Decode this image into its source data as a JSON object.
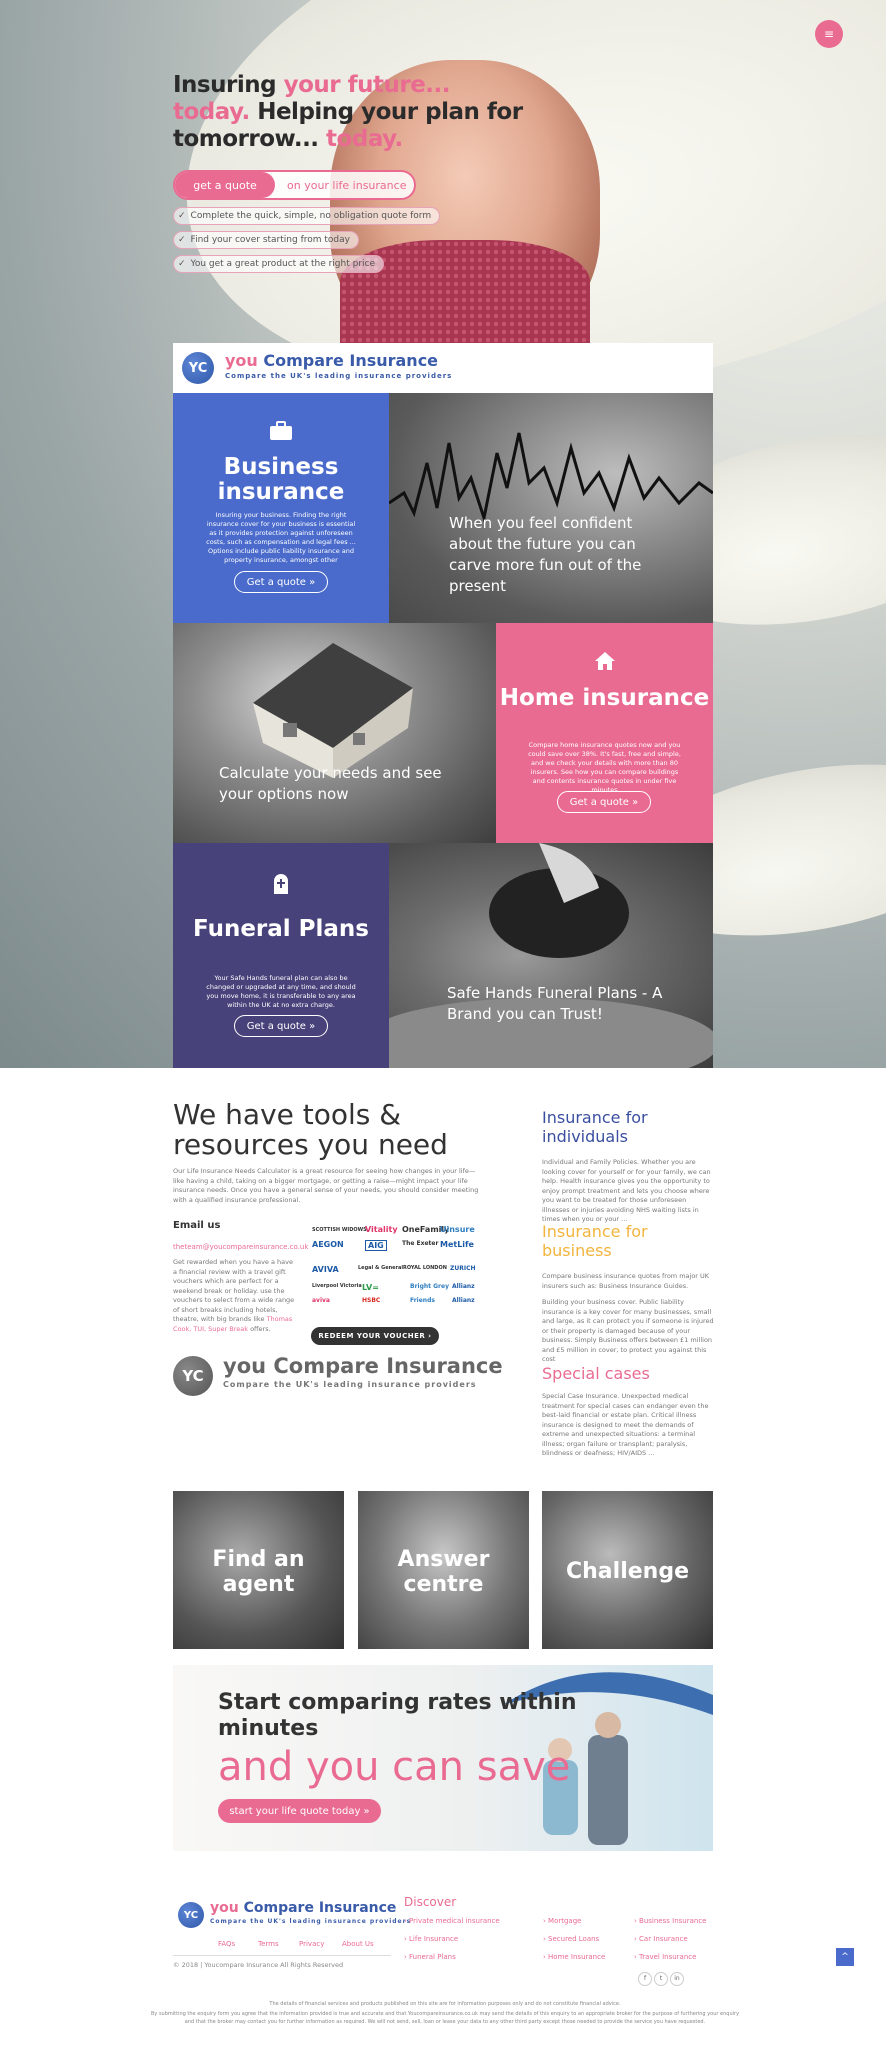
{
  "menu": {
    "icon": "≡"
  },
  "hero": {
    "line1a": "Insuring ",
    "line1b": "your future...",
    "line2a": "today.",
    "line2b": " Helping your plan for",
    "line3a": "tomorrow...",
    "line3b": " today.",
    "cta_button": "get a quote",
    "cta_text": "on your life insurance",
    "checks": [
      "Complete the quick, simple, no obligation quote form",
      "Find your cover starting from today",
      "You get a great product at the right price"
    ]
  },
  "logo": {
    "mark": "YC",
    "name_a": "you ",
    "name_b": "Compare Insurance",
    "tagline": "Compare the UK's leading insurance providers"
  },
  "tiles": {
    "business": {
      "icon": "briefcase-icon",
      "title": "Business insurance",
      "text": "Insuring your business. Finding the right insurance cover for your business is essential as it provides protection against unforeseen costs, such as compensation and legal fees ... Options include public liability insurance and property insurance, amongst other",
      "button": "Get a quote »"
    },
    "confident": {
      "caption": "When you feel confident about the future you can carve more fun out of the present"
    },
    "calculate": {
      "caption": "Calculate your needs and see your options now"
    },
    "home": {
      "icon": "home-icon",
      "title": "Home insurance",
      "text": "Compare home insurance quotes now and you could save over 38%. It's fast, free and simple, and we check your details with more than 80 insurers. See how you can compare buildings and contents insurance quotes in under five minutes",
      "button": "Get a quote »"
    },
    "funeral": {
      "icon": "headstone-icon",
      "title": "Funeral Plans",
      "text": "Your Safe Hands funeral plan can also be changed or upgraded at any time, and should you move home, it is transferable to any area within the UK at no extra charge.",
      "button": "Get a quote »"
    },
    "safehands": {
      "caption": "Safe Hands Funeral Plans - A Brand you can Trust!"
    }
  },
  "tools": {
    "title": "We have tools & resources you need",
    "intro": "Our Life Insurance Needs Calculator is a great resource for seeing how changes in your life—like having a child, taking on a bigger mortgage, or getting a raise—might impact your life insurance needs. Once you have a general sense of your needs, you should consider meeting with a qualified insurance professional.",
    "email_heading": "Email us",
    "email": "theteam@youcompareinsurance.co.uk",
    "voucher_text_a": "Get rewarded when you have a have a financial review with a travel gift vouchers which are perfect for a weekend break or holiday. use the vouchers to select from a wide range of short breaks including hotels, theatre, with big brands like ",
    "voucher_brands": "Thomas Cook, TUI, Super Break",
    "voucher_text_b": " offers.",
    "voucher_button": "REDEEM YOUR VOUCHER ›",
    "brands": [
      "SCOTTISH WIDOWS",
      "Vitality",
      "OneFamily",
      "Uinsure",
      "AEGON",
      "AIG",
      "The Exeter",
      "MetLife",
      "AVIVA",
      "Legal & General",
      "ROYAL LONDON",
      "ZURICH",
      "Liverpool Victoria",
      "LV=",
      "Bright Grey",
      "Allianz",
      "aviva",
      "HSBC",
      "Friends",
      "Allianz"
    ]
  },
  "sidebar": {
    "individuals_title": "Insurance for individuals",
    "individuals_text": "Individual and Family Policies. Whether you are looking cover for yourself or for your family, we can help. Health insurance gives you the opportunity to enjoy prompt treatment and lets you choose where you want to be treated for those unforeseen illnesses or injuries avoiding NHS waiting lists in times when you or your ...",
    "business_title": "Insurance for business",
    "business_text1": "Compare business insurance quotes from major UK insurers such as: Business Insurance Guides.",
    "business_text2": "Building your business cover. Public liability insurance is a key cover for many businesses, small and large, as it can protect you if someone is injured or their property is damaged because of your business. Simply Business offers between £1 million and £5 million in cover, to protect you against this cost",
    "special_title": "Special cases",
    "special_text": "Special Case Insurance. Unexpected medical treatment for special cases can endanger even the best-laid financial or estate plan. Critical illness insurance is designed to meet the demands of extreme and unexpected situations: a terminal illness; organ failure or transplant; paralysis, blindness or deafness; HIV/AIDS ..."
  },
  "bottom_tiles": [
    "Find an agent",
    "Answer centre",
    "Challenge"
  ],
  "compare": {
    "title": "Start comparing rates within minutes",
    "subtitle": "and you can save",
    "button": "start your life quote today »"
  },
  "footer": {
    "nav": [
      "FAQs",
      "Terms",
      "Privacy",
      "About Us"
    ],
    "copyright": "© 2018 | Youcompare Insurance All Rights Reserved",
    "discover": "Discover",
    "links_col1": [
      "Private medical insurance",
      "Life Insurance",
      "Funeral Plans"
    ],
    "links_col2": [
      "Mortgage",
      "Secured Loans",
      "Home Insurance"
    ],
    "links_col3": [
      "Business Insurance",
      "Car Insurance",
      "Travel Insurance"
    ],
    "social": [
      "f",
      "t",
      "in"
    ],
    "disclaimer1": "The details of financial services and products published on this site are for information purposes only and do not constitute financial advice.",
    "disclaimer2": "By submitting the enquiry form you agree that the information provided is true and accurate and that Youcompareinsurance.co.uk may send the details of this enquiry to an appropriate broker for the purpose of furthering your enquiry and that the broker may contact you for further information as required. We will not send, sell, loan or lease your data to any other third party except those needed to provide the service you have requested.",
    "to_top": "^"
  },
  "colors": {
    "pink": "#ea6b92",
    "blue": "#4a6bcb",
    "navy": "#47427a",
    "yellow": "#f2b43d"
  }
}
